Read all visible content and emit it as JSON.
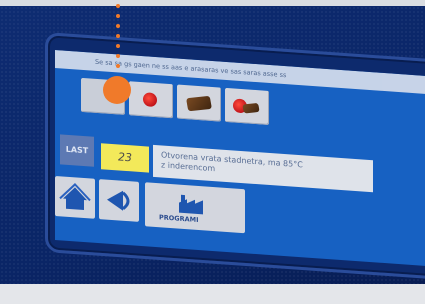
{
  "screen": {
    "header_text": "Se sa sa gs gaen ne ss aas e arasaras ve sas saras asse ss",
    "last_label": "LAST",
    "count_value": "23",
    "message_line1": "Otvorena vrata stadnetra, ma 85°C",
    "message_line2": "z inderencom",
    "programs_label": "PROGRAMI"
  },
  "icons": {
    "home": "home-icon",
    "back": "back-arrow-icon",
    "factory": "factory-icon",
    "red_alarm": "red-alarm-icon",
    "product": "product-icon"
  },
  "colors": {
    "device_navy": "#0a2566",
    "screen_blue": "#1761c2",
    "tile_grey": "#d3d6de",
    "highlight_yellow": "#f3e95a",
    "callout_orange": "#f07a2a",
    "alarm_red": "#e02020"
  }
}
